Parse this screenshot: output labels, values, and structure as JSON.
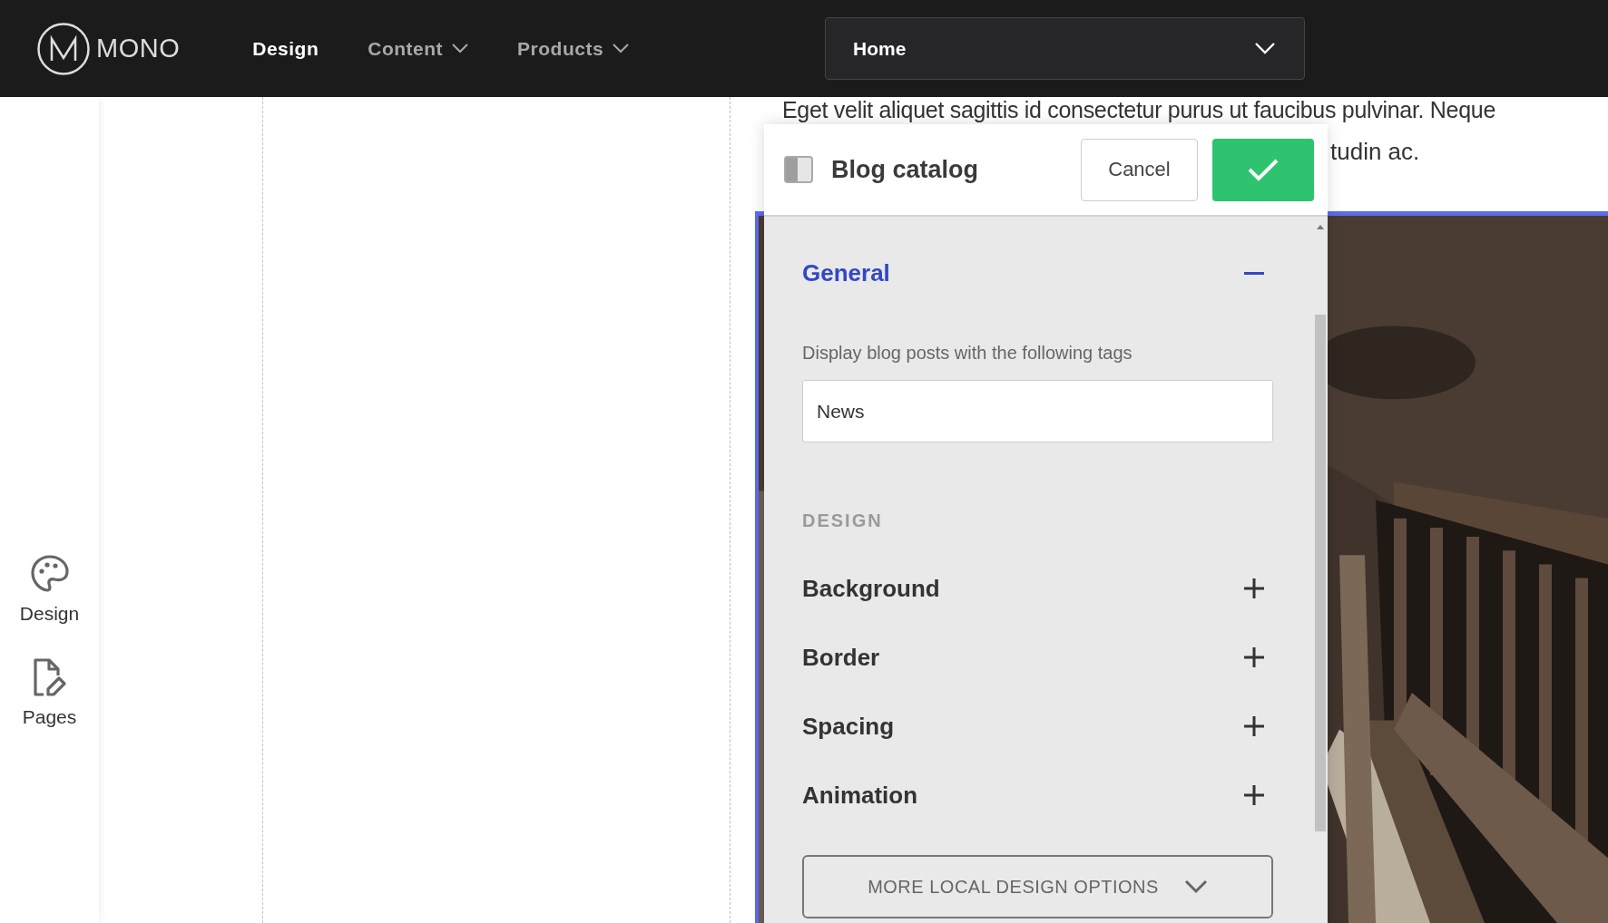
{
  "topbar": {
    "logo": "MONO",
    "nav": [
      {
        "label": "Design",
        "selected": true,
        "dropdown": false
      },
      {
        "label": "Content",
        "selected": false,
        "dropdown": true
      },
      {
        "label": "Products",
        "selected": false,
        "dropdown": true
      }
    ],
    "page_select": {
      "value": "Home"
    }
  },
  "sidebar": {
    "items": [
      {
        "label": "Design",
        "kind": "palette"
      },
      {
        "label": "Pages",
        "kind": "page"
      }
    ]
  },
  "page": {
    "text_lines": [
      "Eget velit aliquet sagittis id consectetur purus ut faucibus pulvinar. Neque",
      "tudin ac."
    ],
    "section": {
      "kind": "picture"
    }
  },
  "panel": {
    "title": "Blog catalog",
    "cancel": "Cancel",
    "general": {
      "title": "General",
      "expanded": true,
      "description": "Display blog posts with the following tags",
      "tags_value": "News"
    },
    "design_heading": "DESIGN",
    "design_sections": [
      {
        "title": "Background",
        "expanded": false
      },
      {
        "title": "Border",
        "expanded": false
      },
      {
        "title": "Spacing",
        "expanded": false
      },
      {
        "title": "Animation",
        "expanded": false
      }
    ],
    "more_button": "MORE LOCAL DESIGN OPTIONS"
  }
}
